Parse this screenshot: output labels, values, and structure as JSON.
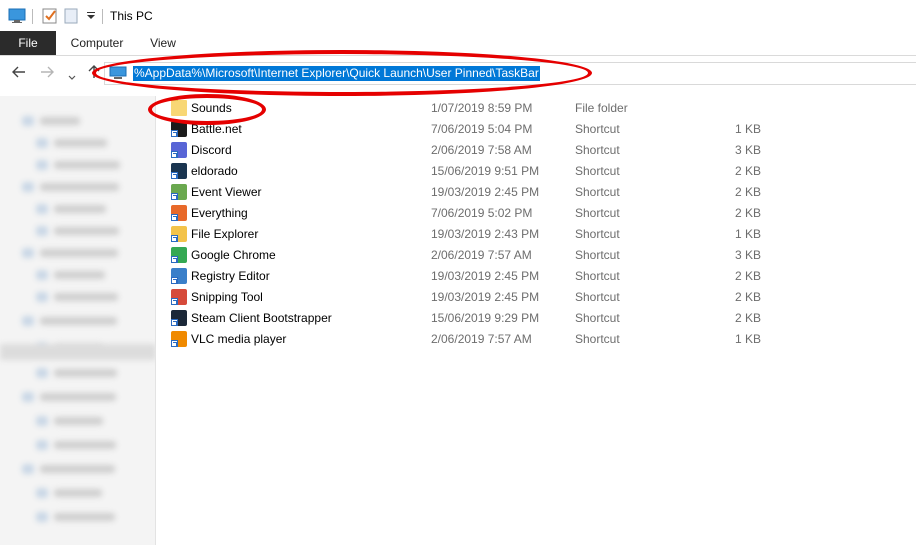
{
  "window": {
    "title": "This PC"
  },
  "ribbon": {
    "tabs": [
      "File",
      "Computer",
      "View"
    ]
  },
  "address": {
    "path": "%AppData%\\Microsoft\\Internet Explorer\\Quick Launch\\User Pinned\\TaskBar"
  },
  "files": [
    {
      "name": "Sounds",
      "date": "1/07/2019 8:59 PM",
      "type": "File folder",
      "size": "",
      "icon": "folder-icon",
      "color": "#f8d775"
    },
    {
      "name": "Battle.net",
      "date": "7/06/2019 5:04 PM",
      "type": "Shortcut",
      "size": "1 KB",
      "icon": "battlenet-icon",
      "color": "#1b1b1b"
    },
    {
      "name": "Discord",
      "date": "2/06/2019 7:58 AM",
      "type": "Shortcut",
      "size": "3 KB",
      "icon": "discord-icon",
      "color": "#5865d6"
    },
    {
      "name": "eldorado",
      "date": "15/06/2019 9:51 PM",
      "type": "Shortcut",
      "size": "2 KB",
      "icon": "eldorado-icon",
      "color": "#1a3550"
    },
    {
      "name": "Event Viewer",
      "date": "19/03/2019 2:45 PM",
      "type": "Shortcut",
      "size": "2 KB",
      "icon": "event-viewer-icon",
      "color": "#6aa84f"
    },
    {
      "name": "Everything",
      "date": "7/06/2019 5:02 PM",
      "type": "Shortcut",
      "size": "2 KB",
      "icon": "everything-icon",
      "color": "#e8692a"
    },
    {
      "name": "File Explorer",
      "date": "19/03/2019 2:43 PM",
      "type": "Shortcut",
      "size": "1 KB",
      "icon": "file-explorer-icon",
      "color": "#f3c34a"
    },
    {
      "name": "Google Chrome",
      "date": "2/06/2019 7:57 AM",
      "type": "Shortcut",
      "size": "3 KB",
      "icon": "chrome-icon",
      "color": "#34a853"
    },
    {
      "name": "Registry Editor",
      "date": "19/03/2019 2:45 PM",
      "type": "Shortcut",
      "size": "2 KB",
      "icon": "registry-editor-icon",
      "color": "#3a7fc9"
    },
    {
      "name": "Snipping Tool",
      "date": "19/03/2019 2:45 PM",
      "type": "Shortcut",
      "size": "2 KB",
      "icon": "snipping-tool-icon",
      "color": "#d64a3a"
    },
    {
      "name": "Steam Client Bootstrapper",
      "date": "15/06/2019 9:29 PM",
      "type": "Shortcut",
      "size": "2 KB",
      "icon": "steam-icon",
      "color": "#1b2838"
    },
    {
      "name": "VLC media player",
      "date": "2/06/2019 7:57 AM",
      "type": "Shortcut",
      "size": "1 KB",
      "icon": "vlc-icon",
      "color": "#f08a00"
    }
  ],
  "colors": {
    "selection": "#0078d7",
    "annotation": "#e50000",
    "file_tab": "#2b2b2b"
  }
}
